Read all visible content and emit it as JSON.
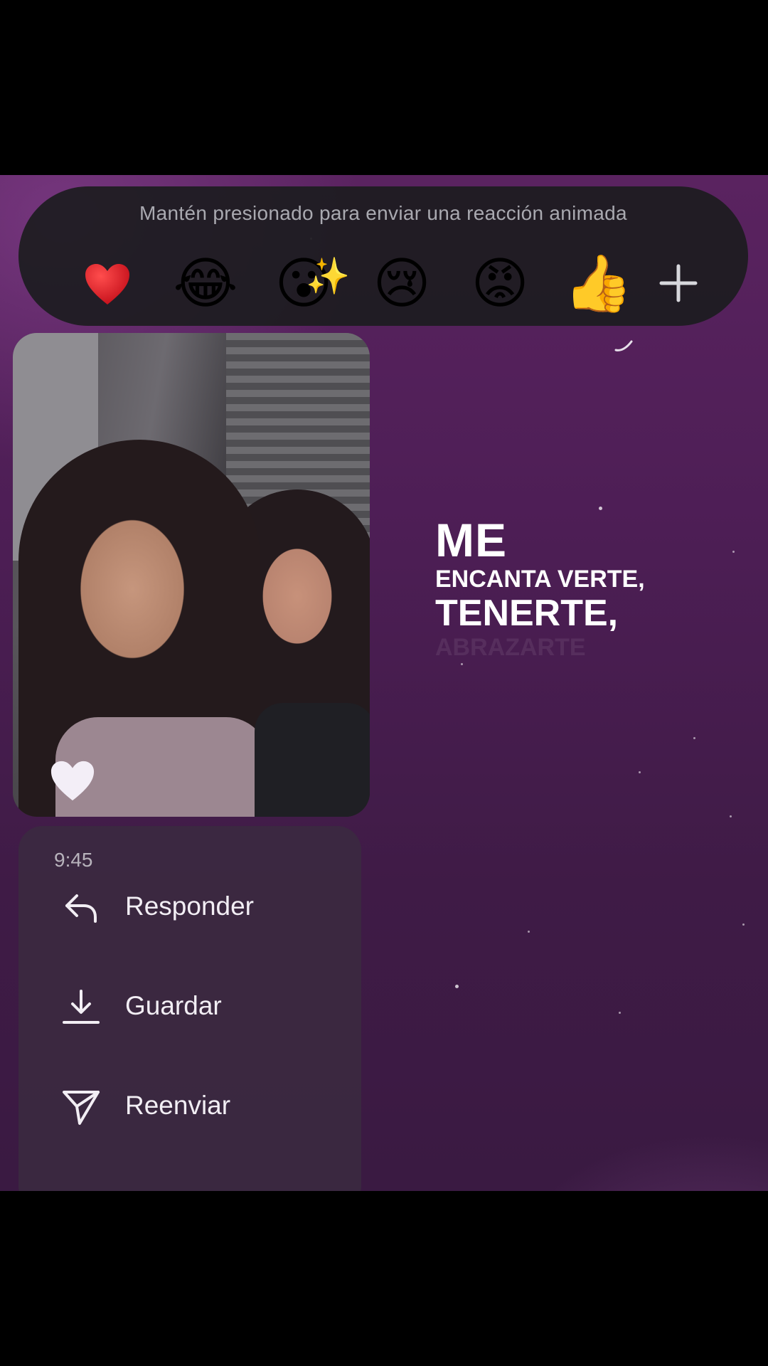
{
  "reaction_bar": {
    "hint": "Mantén presionado para enviar una reacción animada",
    "emojis": [
      {
        "icon": "red-heart-emoji",
        "glyph": ""
      },
      {
        "icon": "tears-of-joy-emoji",
        "glyph": "😂"
      },
      {
        "icon": "astonished-sparkles-emoji",
        "glyph": "😮‍✨"
      },
      {
        "icon": "crying-emoji",
        "glyph": "😢"
      },
      {
        "icon": "angry-emoji",
        "glyph": "😡"
      },
      {
        "icon": "thumbs-up-emoji",
        "glyph": "👍"
      }
    ],
    "more_icon": "plus-icon"
  },
  "message": {
    "photo_alt": "selfie",
    "reaction": "white-heart"
  },
  "lyrics": {
    "line1": "ME",
    "line2": "ENCANTA VERTE,",
    "line3": "TENERTE,",
    "line4": "ABRAZARTE"
  },
  "menu": {
    "time": "9:45",
    "items": [
      {
        "label": "Responder",
        "icon": "reply-icon"
      },
      {
        "label": "Guardar",
        "icon": "download-icon"
      },
      {
        "label": "Reenviar",
        "icon": "send-icon"
      }
    ]
  },
  "colors": {
    "background": "#4d1e55",
    "reaction_bar": "#1c1c20",
    "menu": "#3a2c40",
    "text": "#ffffff"
  }
}
